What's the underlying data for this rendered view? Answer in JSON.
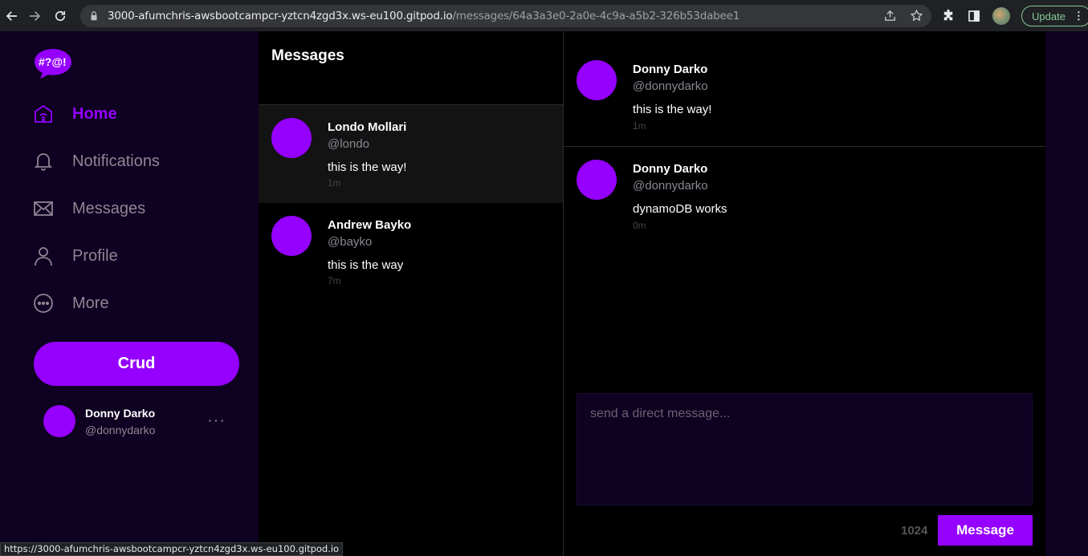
{
  "browser": {
    "url_host": "3000-afumchris-awsbootcampcr-yztcn4zgd3x.ws-eu100.gitpod.io",
    "url_path": "/messages/64a3a3e0-2a0e-4c9a-a5b2-326b53dabee1",
    "update_label": "Update",
    "status_url": "https://3000-afumchris-awsbootcampcr-yztcn4zgd3x.ws-eu100.gitpod.io"
  },
  "sidebar": {
    "logo_text": "#?@!",
    "items": [
      {
        "label": "Home",
        "icon": "home-icon",
        "active": true
      },
      {
        "label": "Notifications",
        "icon": "bell-icon",
        "active": false
      },
      {
        "label": "Messages",
        "icon": "envelope-icon",
        "active": false
      },
      {
        "label": "Profile",
        "icon": "user-icon",
        "active": false
      },
      {
        "label": "More",
        "icon": "more-circle-icon",
        "active": false
      }
    ],
    "crud_label": "Crud",
    "profile": {
      "name": "Donny Darko",
      "handle": "@donnydarko",
      "more": "···"
    }
  },
  "messages": {
    "title": "Messages",
    "groups": [
      {
        "name": "Londo Mollari",
        "handle": "@londo",
        "text": "this is the way!",
        "time": "1m"
      },
      {
        "name": "Andrew Bayko",
        "handle": "@bayko",
        "text": "this is the way",
        "time": "7m"
      }
    ]
  },
  "conversation": {
    "items": [
      {
        "name": "Donny Darko",
        "handle": "@donnydarko",
        "text": "this is the way!",
        "time": "1m"
      },
      {
        "name": "Donny Darko",
        "handle": "@donnydarko",
        "text": "dynamoDB works",
        "time": "0m"
      }
    ],
    "placeholder": "send a direct message...",
    "counter": "1024",
    "send_label": "Message"
  },
  "colors": {
    "accent": "#9500ff",
    "sidebar_bg": "#0e0121",
    "panel_bg": "#000000"
  }
}
